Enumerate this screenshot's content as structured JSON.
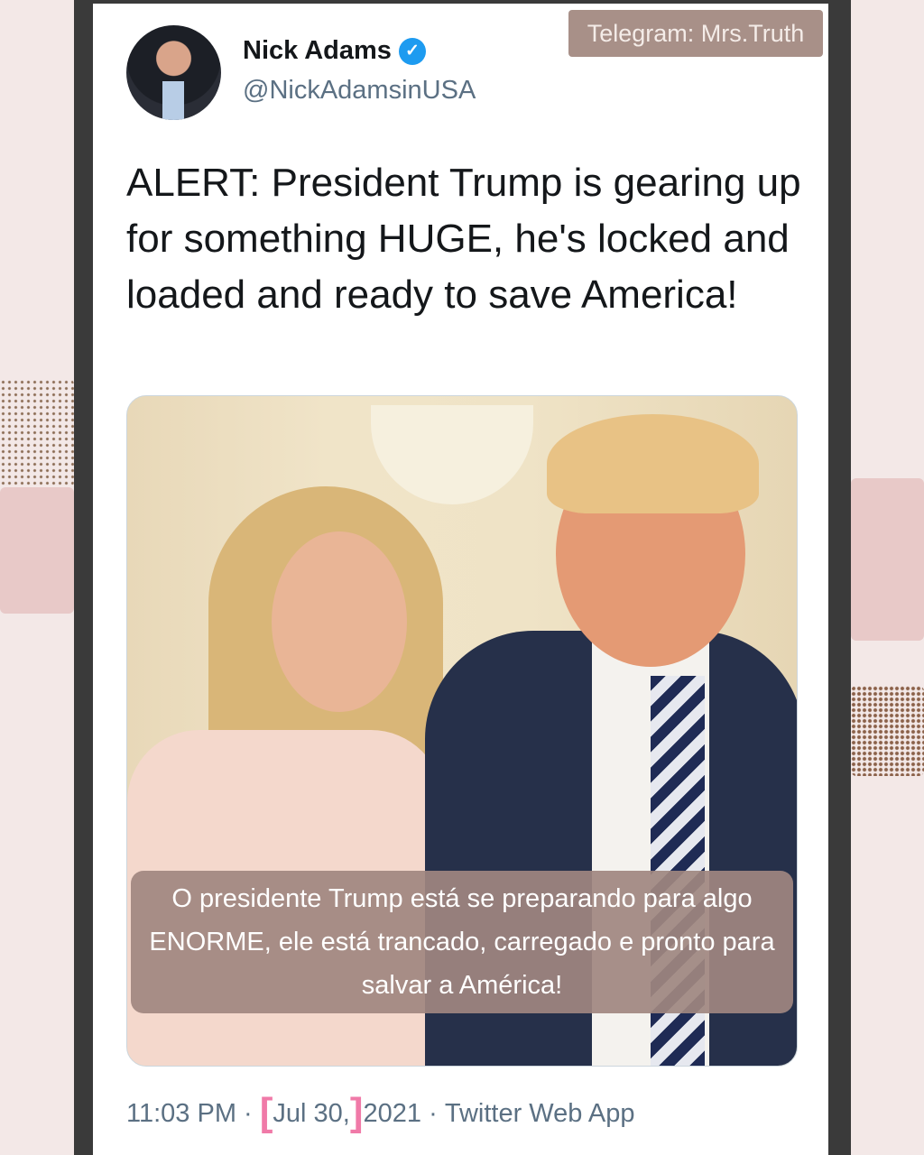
{
  "watermark": "Telegram: Mrs.Truth",
  "tweet": {
    "author_name": "Nick Adams",
    "verified_icon": "verified-badge-icon",
    "handle": "@NickAdamsinUSA",
    "text": "ALERT: President Trump is gearing up for something HUGE, he's locked and loaded and ready to save America!",
    "image_caption": "O presidente Trump está se preparando para algo ENORME, ele está trancado, carregado e pronto para salvar a América!",
    "time": "11:03 PM",
    "sep1": " · ",
    "date_part": "Jul 30,",
    "year": "2021",
    "sep2": " · ",
    "source": "Twitter Web App"
  },
  "colors": {
    "accent": "#1d9bf0",
    "bracket": "#f07aa8",
    "caption_bg": "#a08780"
  }
}
